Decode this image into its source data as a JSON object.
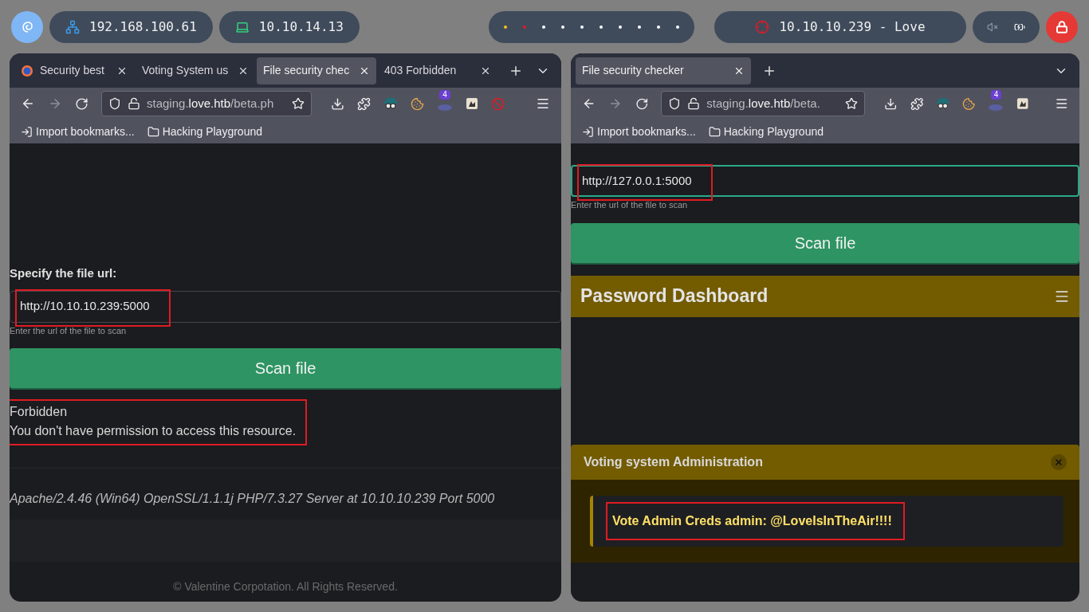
{
  "top_bar": {
    "addresses": [
      {
        "kind": "network",
        "text": "192.168.100.61"
      },
      {
        "kind": "vpn",
        "text": "10.10.14.13"
      }
    ],
    "workspaces": [
      {
        "color": "#f5c211"
      },
      {
        "color": "#e01b24"
      },
      {
        "color": "#ffffff"
      },
      {
        "color": "#ffffff"
      },
      {
        "color": "#ffffff"
      },
      {
        "color": "#ffffff"
      },
      {
        "color": "#ffffff"
      },
      {
        "color": "#ffffff"
      },
      {
        "color": "#ffffff"
      },
      {
        "color": "#ffffff"
      }
    ],
    "target": "10.10.10.239 - Love",
    "muted": true
  },
  "windows": [
    {
      "tabs": [
        {
          "title": "Security best",
          "favicon": true,
          "selected": false
        },
        {
          "title": "Voting System us",
          "favicon": false,
          "selected": false
        },
        {
          "title": "File security chec",
          "favicon": false,
          "selected": true
        },
        {
          "title": "403 Forbidden",
          "favicon": false,
          "selected": false
        }
      ],
      "url": {
        "host": "staging.love.htb",
        "path": "/beta.ph"
      },
      "addons": [
        {
          "kind": "spy"
        },
        {
          "kind": "cookie"
        },
        {
          "kind": "php",
          "badge": "4"
        },
        {
          "kind": "tile"
        },
        {
          "kind": "block"
        }
      ],
      "bookmarks": [
        {
          "kind": "import",
          "text": "Import bookmarks..."
        },
        {
          "kind": "folder",
          "text": "Hacking Playground"
        }
      ],
      "content": [
        {
          "kind": "blank"
        },
        {
          "kind": "label",
          "text": "Specify the file url:"
        },
        {
          "kind": "field",
          "value": "http://10.10.10.239:5000",
          "focused": false,
          "highlighted": true
        },
        {
          "kind": "hint",
          "text": "Enter the url of the file to scan"
        },
        {
          "kind": "button",
          "text": "Scan file"
        },
        {
          "kind": "message",
          "lines": [
            "Forbidden",
            "You don't have permission to access this resource."
          ],
          "highlighted": true
        },
        {
          "kind": "server",
          "text": "Apache/2.4.46 (Win64) OpenSSL/1.1.1j PHP/7.3.27 Server at 10.10.10.239 Port 5000"
        },
        {
          "kind": "footer",
          "text": "© Valentine Corpotation. All Rights Reserved."
        }
      ]
    },
    {
      "tabs": [
        {
          "title": "File security checker",
          "favicon": false,
          "selected": true
        }
      ],
      "url": {
        "host": "staging.love.htb",
        "path": "/beta."
      },
      "addons": [
        {
          "kind": "spy"
        },
        {
          "kind": "cookie"
        },
        {
          "kind": "php",
          "badge": "4"
        },
        {
          "kind": "tile"
        }
      ],
      "bookmarks": [
        {
          "kind": "import",
          "text": "Import bookmarks..."
        },
        {
          "kind": "folder",
          "text": "Hacking Playground"
        }
      ],
      "content": [
        {
          "kind": "field",
          "value": "http://127.0.0.1:5000",
          "focused": true,
          "highlighted": true
        },
        {
          "kind": "hint",
          "text": "Enter the url of the file to scan"
        },
        {
          "kind": "button",
          "text": "Scan file"
        },
        {
          "kind": "navbar",
          "text": "Password Dashboard"
        },
        {
          "kind": "alert",
          "title": "Voting system Administration",
          "text": "Vote Admin Creds admin: @LoveIsInTheAir!!!!",
          "highlighted": true
        }
      ]
    }
  ]
}
